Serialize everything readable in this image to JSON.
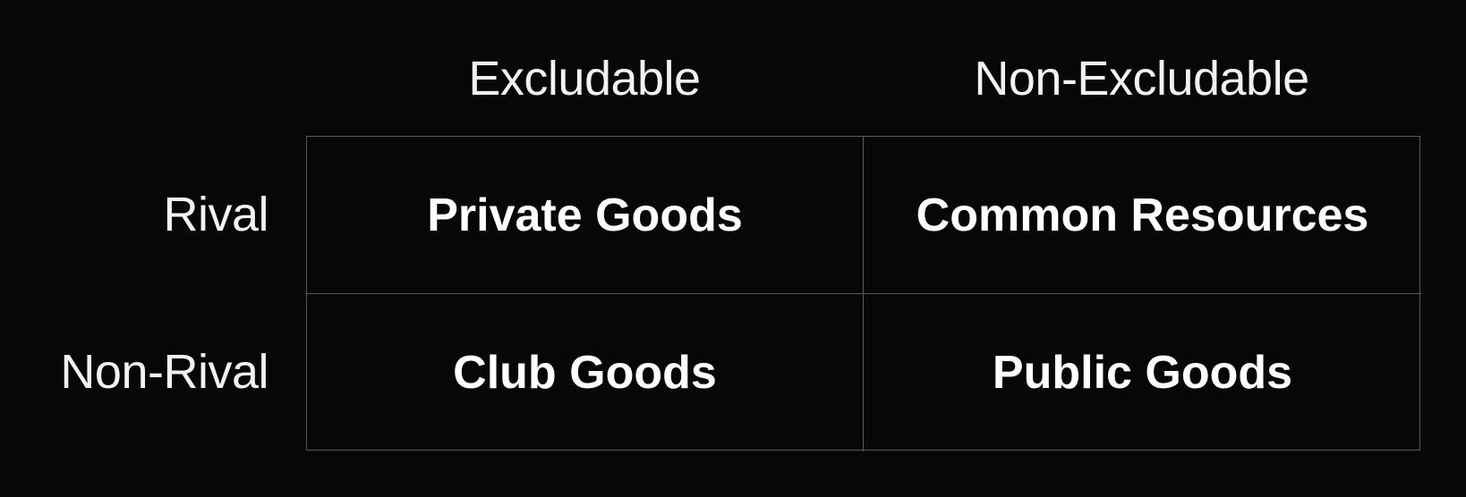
{
  "matrix": {
    "column_headers": [
      "Excludable",
      "Non-Excludable"
    ],
    "row_headers": [
      "Rival",
      "Non-Rival"
    ],
    "cells": [
      [
        "Private Goods",
        "Common Resources"
      ],
      [
        "Club Goods",
        "Public Goods"
      ]
    ]
  },
  "colors": {
    "background": "#070707",
    "text": "#ffffff",
    "grid_line": "#5a5a5a"
  }
}
